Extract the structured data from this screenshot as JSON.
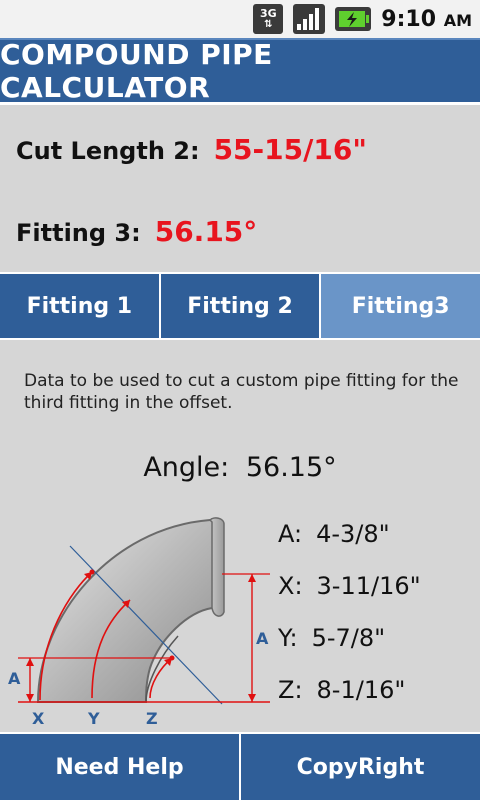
{
  "status_bar": {
    "network_icon": "3g-data-icon",
    "network_top": "3G",
    "signal_icon": "signal-bars-icon",
    "battery_icon": "battery-charging-icon",
    "time": "9:10",
    "ampm": "AM"
  },
  "header": {
    "title": "COMPOUND PIPE CALCULATOR"
  },
  "results": {
    "cut_length_label": "Cut Length 2:",
    "cut_length_value": "55-15/16\"",
    "fitting_label": "Fitting 3:",
    "fitting_value": "56.15°"
  },
  "tabs": [
    {
      "label": "Fitting 1",
      "active": false
    },
    {
      "label": "Fitting 2",
      "active": false
    },
    {
      "label": "Fitting3",
      "active": true
    }
  ],
  "content": {
    "description": "Data to be used to cut a custom pipe fitting for the third fitting in the offset.",
    "angle_label": "Angle:",
    "angle_value": "56.15°",
    "diagram_labels": {
      "a": "A",
      "x": "X",
      "y": "Y",
      "z": "Z"
    },
    "measurements": [
      {
        "label": "A:",
        "value": "4-3/8\""
      },
      {
        "label": "X:",
        "value": "3-11/16\""
      },
      {
        "label": "Y:",
        "value": "5-7/8\""
      },
      {
        "label": "Z:",
        "value": "8-1/16\""
      }
    ]
  },
  "footer": {
    "help_label": "Need Help",
    "copyright_label": "CopyRight"
  },
  "colors": {
    "header_blue": "#2f5e98",
    "active_tab": "#6a95c8",
    "result_red": "#e8141e",
    "diagram_line_red": "#e01010",
    "diagram_label_blue": "#2f5e98"
  }
}
